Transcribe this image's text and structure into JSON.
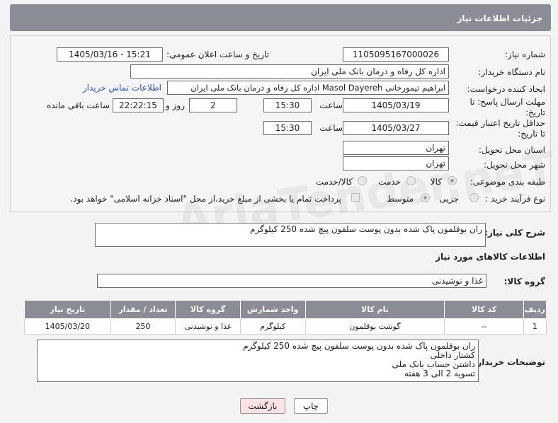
{
  "header": {
    "title": "جزئیات اطلاعات نیاز"
  },
  "fields": {
    "need_number_label": "شماره نیاز:",
    "need_number": "1105095167000026",
    "announce_label": "تاریخ و ساعت اعلان عمومی:",
    "announce_value": "1405/03/16 - 15:21",
    "buyer_org_label": "نام دستگاه خریدار:",
    "buyer_org": "اداره کل رفاه و درمان بانک ملی ایران",
    "creator_label": "ایجاد کننده درخواست:",
    "creator": "ابراهیم تیمورخانی Masol Dayereh اداره کل رفاه و درمان بانک ملی ایران",
    "contact_link": "اطلاعات تماس خریدار",
    "deadline_label": "مهلت ارسال پاسخ: تا تاریخ:",
    "deadline_date": "1405/03/19",
    "time_label": "ساعت",
    "deadline_time": "15:30",
    "days_value": "2",
    "days_label": "روز و",
    "remaining_time": "22:22:15",
    "remaining_label": "ساعت باقی مانده",
    "validity_label": "حداقل تاریخ اعتبار قیمت: تا تاریخ:",
    "validity_date": "1405/03/27",
    "validity_time": "15:30",
    "province_label": "استان محل تحویل:",
    "province": "تهران",
    "city_label": "شهر محل تحویل:",
    "city": "تهران",
    "category_label": "طبقه بندی موضوعی:",
    "category_options": [
      "کالا",
      "خدمت",
      "کالا/خدمت"
    ],
    "process_label": "نوع فرآیند خرید :",
    "process_options": [
      "جزیی",
      "متوسط"
    ],
    "payment_note": "پرداخت تمام یا بخشی از مبلغ خرید،از محل \"اسناد خزانه اسلامی\" خواهد بود."
  },
  "summary": {
    "label": "شرح کلی نیاز:",
    "value": "ران بوقلمون پاک شده بدون پوست سلفون پیچ شده 250 کیلوگرم"
  },
  "goods": {
    "section_title": "اطلاعات کالاهای مورد نیاز",
    "group_label": "گروه کالا:",
    "group_value": "غذا و نوشیدنی",
    "columns": [
      "ردیف",
      "کد کالا",
      "نام کالا",
      "واحد شمارش",
      "گروه کالا",
      "تعداد / مقدار",
      "تاریخ نیاز"
    ],
    "rows": [
      [
        "1",
        "--",
        "گوشت بوقلمون",
        "کیلوگرم",
        "غذا و نوشیدنی",
        "250",
        "1405/03/20"
      ]
    ]
  },
  "buyer_notes": {
    "label": "توضیحات خریدار:",
    "text": "ران بوقلمون پاک شده بدون پوست سلفون پیچ شده 250 کیلوگرم\nکشتار داخلی\nداشتن حساب بانک ملی\nتسویه 2 الی 3 هفته"
  },
  "buttons": {
    "print": "چاپ",
    "back": "بازگشت"
  },
  "watermark": "AriaTender.neT"
}
